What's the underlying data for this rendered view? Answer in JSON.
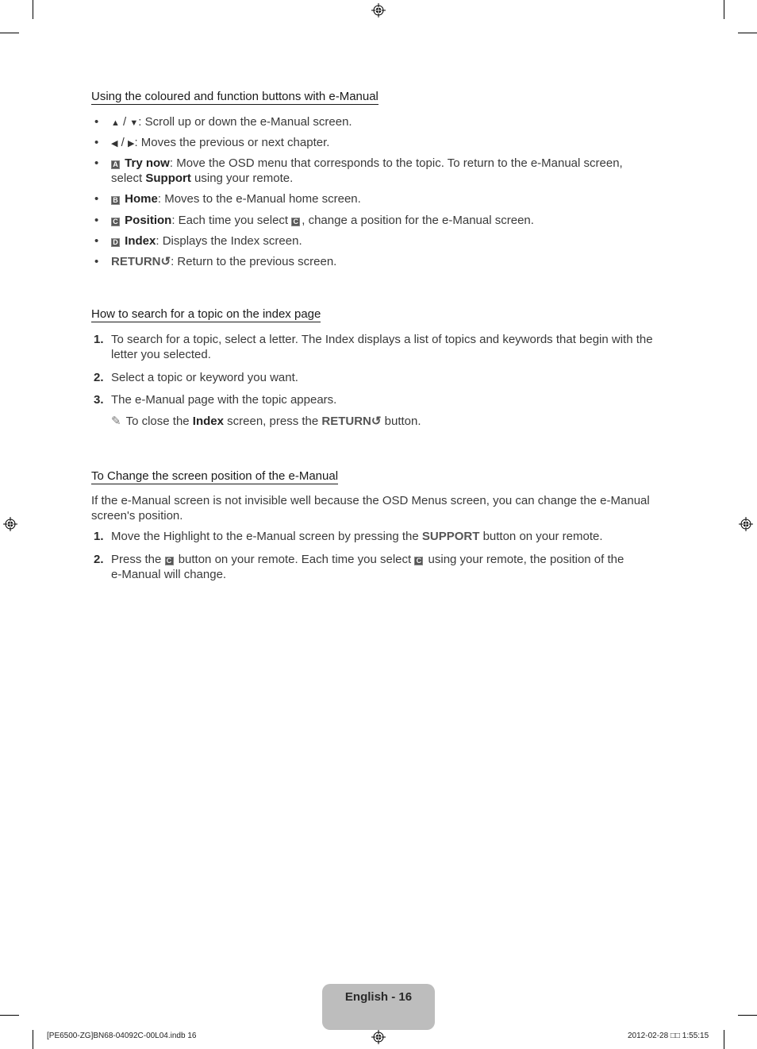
{
  "sections": [
    {
      "title": "Using the coloured and function buttons with e-Manual",
      "bullets": [
        {
          "icon": "up-down-arrows",
          "icon_text_a": "▲",
          "sep": " / ",
          "icon_text_b": "▼",
          "text": ": Scroll up or down the e-Manual screen."
        },
        {
          "icon": "left-right-arrows",
          "icon_text_a": "◀",
          "sep": " / ",
          "icon_text_b": "▶",
          "text": ": Moves the previous or next chapter."
        },
        {
          "key": "A",
          "label": "Try now",
          "text": ": Move the OSD menu that corresponds to the topic. To return to the e-Manual screen,",
          "text2_pre": "select ",
          "text2_bold": "Support",
          "text2_post": " using your remote."
        },
        {
          "key": "B",
          "label": "Home",
          "text": ": Moves to the e-Manual home screen."
        },
        {
          "key": "C",
          "label": "Position",
          "text_pre": ": Each time you select ",
          "inline_key": "C",
          "text_post": ", change a position for the e-Manual screen."
        },
        {
          "key": "D",
          "label": "Index",
          "text": ": Displays the Index screen."
        },
        {
          "label": "RETURN",
          "return_symbol": "↺",
          "text": ": Return to the previous screen."
        }
      ]
    },
    {
      "title": "How to search for a topic on the index page",
      "steps": [
        {
          "num": "1.",
          "line1": "To search for a topic, select a letter. The Index displays a list of topics and keywords that begin with the",
          "line2": "letter you selected."
        },
        {
          "num": "2.",
          "line1": "Select a topic or keyword you want."
        },
        {
          "num": "3.",
          "line1": "The e-Manual page with the topic appears."
        }
      ],
      "note": {
        "icon": "✎",
        "pre": "To close the ",
        "bold": "Index",
        "mid": " screen, press the ",
        "ret": "RETURN",
        "ret_symbol": "↺",
        "post": " button."
      }
    },
    {
      "title": "To Change the screen position of the e-Manual",
      "intro_line1": "If the e-Manual screen is not invisible well because the OSD Menus screen, you can change the e-Manual",
      "intro_line2": "screen's position.",
      "steps": [
        {
          "num": "1.",
          "pre": "Move the Highlight to the e-Manual screen by pressing the ",
          "bold": "SUPPORT",
          "post": " button on your remote."
        },
        {
          "num": "2.",
          "pre": "Press the ",
          "key1": "C",
          "mid": " button on your remote. Each time you select ",
          "key2": "C",
          "post": " using your remote, the position of the",
          "line2": "e-Manual will change."
        }
      ]
    }
  ],
  "footer": {
    "page_label": "English - 16",
    "slug_left": "[PE6500-ZG]BN68-04092C-00L04.indb   16",
    "slug_right": "2012-02-28   □□ 1:55:15"
  }
}
